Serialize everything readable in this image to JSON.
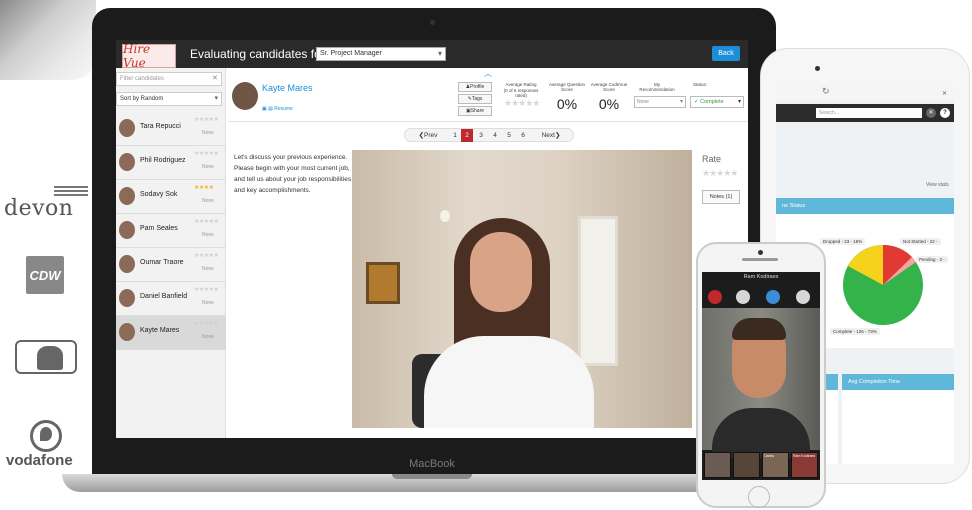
{
  "logos": {
    "devon": "devon",
    "cdw": "CDW",
    "vodafone": "vodafone"
  },
  "laptop": {
    "device_label": "MacBook",
    "app": {
      "logo_text": "Hire Vue",
      "evaluating_label": "Evaluating candidates for:",
      "position_select": "Sr. Project Manager",
      "back_button": "Back",
      "filter_placeholder": "Filter candidates",
      "sort_select": "Sort by Random",
      "candidates": [
        {
          "name": "Tara Repucci",
          "rating": "★★★★★",
          "recommendation": "None"
        },
        {
          "name": "Phil Rodriguez",
          "rating": "★★★★★",
          "recommendation": "None"
        },
        {
          "name": "Sodavy Sok",
          "rating": "★★★★",
          "recommendation": "None"
        },
        {
          "name": "Pam Seales",
          "rating": "★★★★★",
          "recommendation": "None"
        },
        {
          "name": "Oumar Traore",
          "rating": "★★★★★",
          "recommendation": "None"
        },
        {
          "name": "Daniel Banfield",
          "rating": "★★★★★",
          "recommendation": "None"
        },
        {
          "name": "Kayte Mares",
          "rating": "★★★★★",
          "recommendation": "None"
        }
      ],
      "selected_candidate": {
        "name": "Kayte Mares",
        "resume_link": "Resume"
      },
      "buttons": {
        "profile": "Profile",
        "tags": "Tags",
        "share": "Share"
      },
      "metrics": {
        "avg_rating_label": "Average Rating",
        "avg_rating_sub": "(0 of 6 responses rated)",
        "avg_rating_stars": "★★★★★",
        "avg_question_label": "Average Question Score",
        "avg_question_value": "0%",
        "avg_cognitive_label": "Average CodeVue Score",
        "avg_cognitive_value": "0%",
        "recommendation_label": "My Recommendation",
        "recommendation_value": "None",
        "status_label": "Status:",
        "status_value": "✓ Complete"
      },
      "pager": {
        "prev": "❮Prev",
        "pages": [
          "1",
          "2",
          "3",
          "4",
          "5",
          "6"
        ],
        "current": "2",
        "next": "Next❯"
      },
      "question": "Let's discuss your previous experience. Please begin with your most current job, and tell us about your job responsibilities and key accomplishments.",
      "rate_label": "Rate",
      "rate_stars": "★★★★★",
      "notes_button": "Notes (1)"
    }
  },
  "tablet": {
    "search_placeholder": "Search...",
    "view_label": "View stats",
    "panel_status_title": "ne Status",
    "pie": {
      "dropped": "Dropped - 23 - 15%",
      "not_started": "Not Started - 22 -",
      "pending": "Pending - 3 -",
      "complete": "Complete - 126 - 73%"
    },
    "panel_avg_title": "Avg Completion Time",
    "colors": {
      "complete": "#33b34a",
      "dropped": "#f5d21c",
      "not_started": "#e23a32",
      "pending": "#f7a1a1"
    }
  },
  "phone": {
    "title": "Ram Kodiraes",
    "thumbs": [
      "",
      "",
      "Carlos",
      "Ram Kodiraes"
    ]
  },
  "colors": {
    "accent": "#1a8fd8",
    "brand_red": "#c0282e",
    "topbar": "#2a2a2a"
  }
}
